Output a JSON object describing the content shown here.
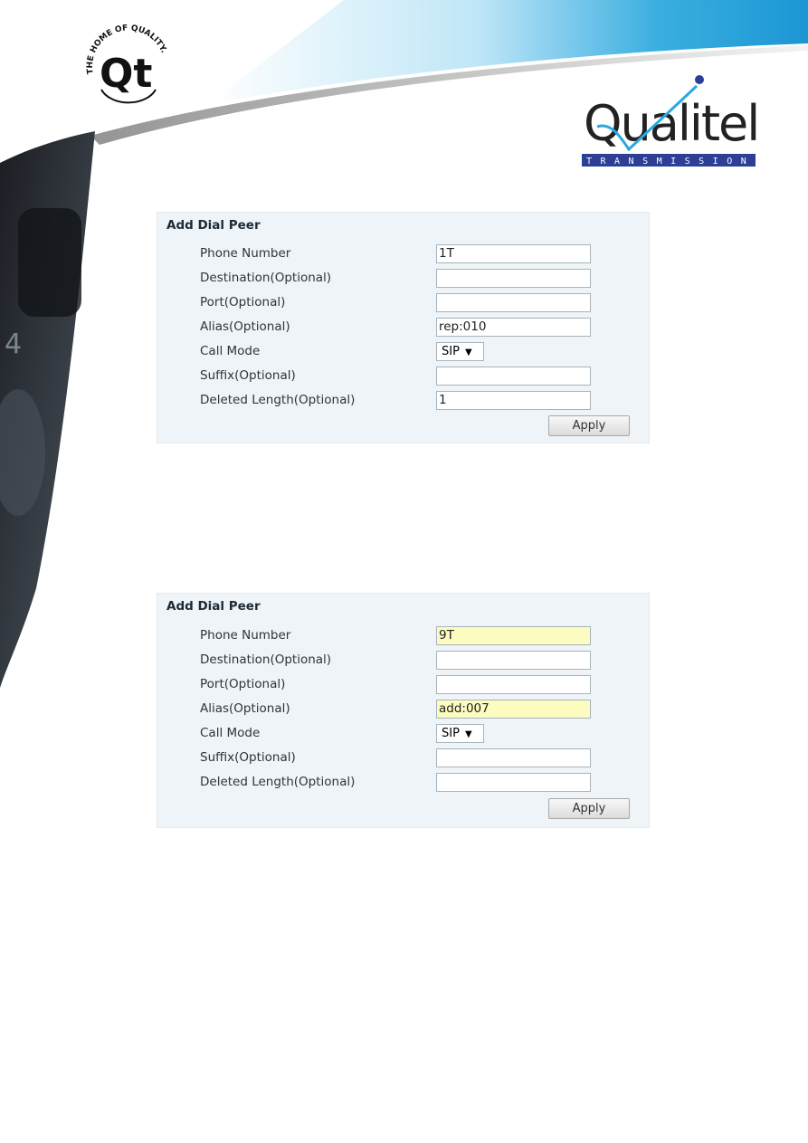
{
  "header": {
    "left_logo_text": "THE HOME OF QUALITY · Qt",
    "right_logo_text": "Qualitel",
    "right_logo_subtext": "TRANSMISSION",
    "accent_color": "#2c3e95",
    "swoosh_color": "#3aaee0"
  },
  "panels": [
    {
      "title": "Add Dial Peer",
      "fields": [
        {
          "label": "Phone Number",
          "value": "1T",
          "highlighted": false
        },
        {
          "label": "Destination(Optional)",
          "value": "",
          "highlighted": false
        },
        {
          "label": "Port(Optional)",
          "value": "",
          "highlighted": false
        },
        {
          "label": "Alias(Optional)",
          "value": "rep:010",
          "highlighted": false
        },
        {
          "label": "Call Mode",
          "value": "SIP",
          "type": "select"
        },
        {
          "label": "Suffix(Optional)",
          "value": "",
          "highlighted": false
        },
        {
          "label": "Deleted Length(Optional)",
          "value": "1",
          "highlighted": false
        }
      ],
      "apply_label": "Apply"
    },
    {
      "title": "Add Dial Peer",
      "fields": [
        {
          "label": "Phone Number",
          "value": "9T",
          "highlighted": true
        },
        {
          "label": "Destination(Optional)",
          "value": "",
          "highlighted": false
        },
        {
          "label": "Port(Optional)",
          "value": "",
          "highlighted": false
        },
        {
          "label": "Alias(Optional)",
          "value": "add:007",
          "highlighted": true
        },
        {
          "label": "Call Mode",
          "value": "SIP",
          "type": "select"
        },
        {
          "label": "Suffix(Optional)",
          "value": "",
          "highlighted": false
        },
        {
          "label": "Deleted Length(Optional)",
          "value": "",
          "highlighted": false
        }
      ],
      "apply_label": "Apply"
    }
  ]
}
